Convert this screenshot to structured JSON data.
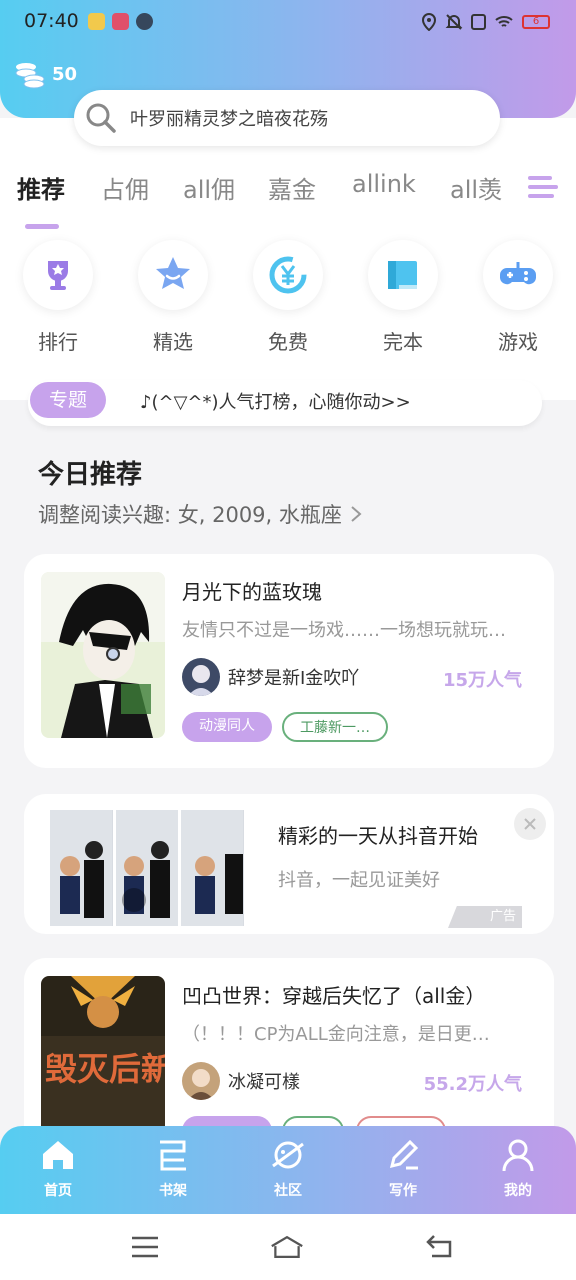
{
  "status": {
    "time": "07:40",
    "battery": "6"
  },
  "coins": {
    "count": "50"
  },
  "search": {
    "placeholder": "叶罗丽精灵梦之暗夜花殇"
  },
  "tabs": [
    "推荐",
    "占佣",
    "all佣",
    "嘉金",
    "allink",
    "all羡"
  ],
  "quick": [
    {
      "label": "排行",
      "icon": "trophy-icon"
    },
    {
      "label": "精选",
      "icon": "star-icon"
    },
    {
      "label": "免费",
      "icon": "yuan-icon"
    },
    {
      "label": "完本",
      "icon": "book-icon"
    },
    {
      "label": "游戏",
      "icon": "gamepad-icon"
    }
  ],
  "topic": {
    "badge": "专题",
    "text": "♪(^▽^*)人气打榜，心随你动>>"
  },
  "recommend": {
    "title": "今日推荐",
    "subtitle": "调整阅读兴趣: 女, 2009, 水瓶座"
  },
  "books": [
    {
      "title": "月光下的蓝玫瑰",
      "desc": "友情只不过是一场戏……一场想玩就玩…",
      "author": "辞梦是新I金吹吖",
      "popularity": "15万人气",
      "tags": [
        "动漫同人",
        "工藤新一…"
      ]
    },
    {
      "title": "凹凸世界：穿越后失忆了（all金）",
      "desc": "（！！！CP为ALL金向注意，是日更…",
      "author": "冰凝可樣",
      "popularity": "55.2万人气",
      "cover_text": "毁灭后新生"
    }
  ],
  "ad": {
    "title": "精彩的一天从抖音开始",
    "subtitle": "抖音，一起见证美好",
    "label": "广告"
  },
  "nav": [
    "首页",
    "书架",
    "社区",
    "写作",
    "我的"
  ]
}
